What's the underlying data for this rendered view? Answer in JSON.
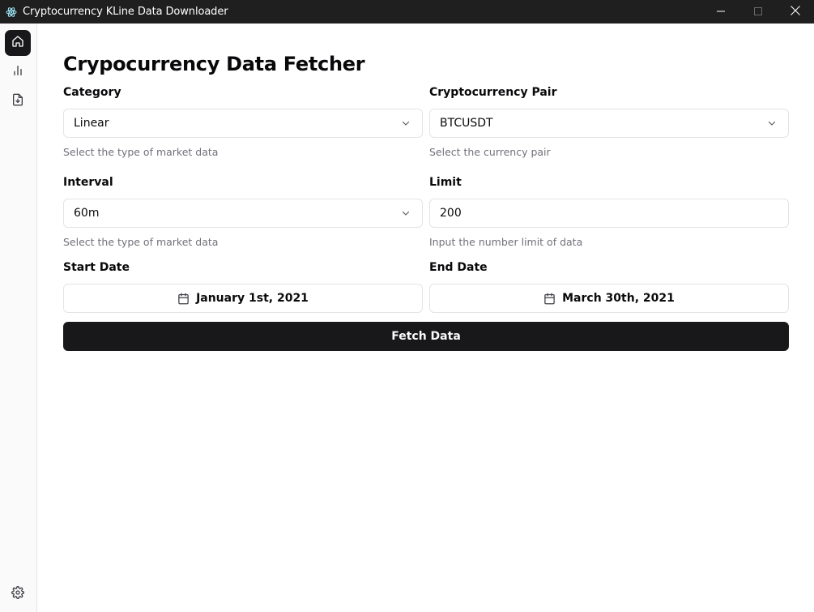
{
  "window": {
    "title": "Cryptocurrency KLine Data Downloader",
    "app_icon": "electron-icon",
    "controls": [
      "minimize-icon",
      "maximize-icon",
      "close-icon"
    ]
  },
  "sidebar": {
    "items": [
      {
        "icon": "home-icon",
        "active": true
      },
      {
        "icon": "bar-chart-icon",
        "active": false
      },
      {
        "icon": "file-download-icon",
        "active": false
      }
    ],
    "footer_icon": "settings-icon"
  },
  "page": {
    "title": "Crypocurrency Data Fetcher"
  },
  "form": {
    "category": {
      "label": "Category",
      "value": "Linear",
      "helper": "Select the type of market data"
    },
    "pair": {
      "label": "Cryptocurrency Pair",
      "value": "BTCUSDT",
      "helper": "Select the currency pair"
    },
    "interval": {
      "label": "Interval",
      "value": "60m",
      "helper": "Select the type of market data"
    },
    "limit": {
      "label": "Limit",
      "value": "200",
      "helper": "Input the number limit of data"
    },
    "start_date": {
      "label": "Start Date",
      "value": "January 1st, 2021"
    },
    "end_date": {
      "label": "End Date",
      "value": "March 30th, 2021"
    },
    "submit_label": "Fetch Data"
  },
  "colors": {
    "primary": "#18181b",
    "border": "#e4e4e7",
    "muted_text": "#71717a",
    "titlebar": "#1f1f1f"
  }
}
